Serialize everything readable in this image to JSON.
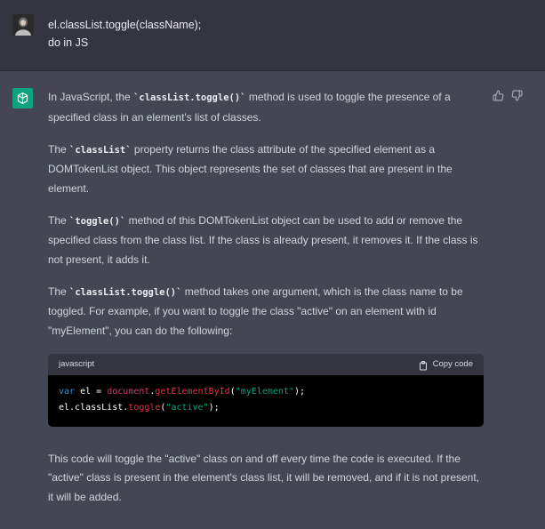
{
  "user": {
    "line1": "el.classList.toggle(className);",
    "line2": "do in JS"
  },
  "assistant": {
    "p1": {
      "t1": "In JavaScript, the ",
      "c1": "`classList.toggle()`",
      "t2": " method is used to toggle the presence of a specified class in an element's list of classes."
    },
    "p2": {
      "t1": "The ",
      "c1": "`classList`",
      "t2": " property returns the class attribute of the specified element as a DOMTokenList object. This object represents the set of classes that are present in the element."
    },
    "p3": {
      "t1": "The ",
      "c1": "`toggle()`",
      "t2": " method of this DOMTokenList object can be used to add or remove the specified class from the class list. If the class is already present, it removes it. If the class is not present, it adds it."
    },
    "p4": {
      "t1": "The ",
      "c1": "`classList.toggle()`",
      "t2": " method takes one argument, which is the class name to be toggled. For example, if you want to toggle the class \"active\" on an element with id \"myElement\", you can do the following:"
    },
    "code": {
      "language": "javascript",
      "copy_label": "Copy code",
      "l1": {
        "kw": "var",
        "sp1": " el = ",
        "obj": "document",
        "dot": ".",
        "fn": "getElementById",
        "open": "(",
        "str": "\"myElement\"",
        "close": ");"
      },
      "l2": {
        "pre": "el.classList.",
        "fn": "toggle",
        "open": "(",
        "str": "\"active\"",
        "close": ");"
      }
    },
    "p5": "This code will toggle the \"active\" class on and off every time the code is executed. If the \"active\" class is present in the element's class list, it will be removed, and if it is not present, it will be added."
  },
  "icons": {
    "logo": "openai-logo",
    "thumbs_up": "thumbs-up-icon",
    "thumbs_down": "thumbs-down-icon",
    "copy": "clipboard-icon"
  },
  "colors": {
    "accent": "#10a37f",
    "user_bg": "#343541",
    "assistant_bg": "#444654"
  }
}
